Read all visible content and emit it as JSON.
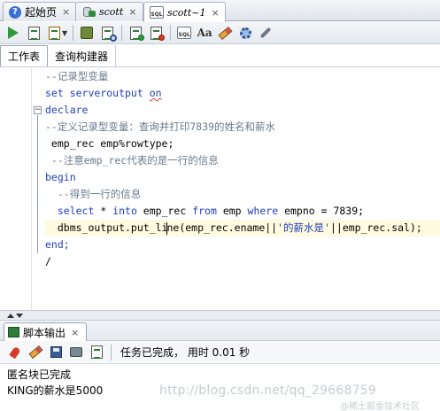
{
  "doc_tabs": [
    {
      "label": "起始页",
      "icon": "help-icon",
      "close": "×"
    },
    {
      "label": "scott",
      "icon": "database-connection-icon",
      "close": "×"
    },
    {
      "label": "scott~1",
      "icon": "sql-worksheet-icon",
      "close": "×",
      "active": true
    }
  ],
  "toolbar": {
    "items": [
      "run-statement-icon",
      "run-script-icon",
      "commit-icon",
      "rollback-icon",
      "explain-plan-icon",
      "autotrace-icon",
      "sql-history-icon",
      "to-upper-lower-icon",
      "clear-icon",
      "tuning-advisor-icon",
      "monitor-icon"
    ]
  },
  "sub_tabs": [
    "工作表",
    "查询构建器"
  ],
  "editor": {
    "lines": [
      {
        "parts": [
          {
            "t": "--记录型变量",
            "c": "cmt"
          }
        ]
      },
      {
        "parts": [
          {
            "t": "set serveroutput ",
            "c": "kw"
          },
          {
            "t": "on",
            "c": "kw squiggle"
          }
        ]
      },
      {
        "parts": [
          {
            "t": "declare",
            "c": "kw"
          }
        ]
      },
      {
        "parts": [
          {
            "t": "--定义记录型变量：查询并打印7839的姓名和薪水",
            "c": "cmt"
          }
        ]
      },
      {
        "parts": [
          {
            "t": " emp_rec emp%rowtype;",
            "c": "plain"
          }
        ]
      },
      {
        "parts": [
          {
            "t": " --注意emp_rec代表的是一行的信息",
            "c": "cmt"
          }
        ]
      },
      {
        "parts": [
          {
            "t": "begin",
            "c": "kw"
          }
        ]
      },
      {
        "parts": [
          {
            "t": "  --得到一行的信息",
            "c": "cmt"
          }
        ]
      },
      {
        "parts": [
          {
            "t": "  select",
            "c": "kw"
          },
          {
            "t": " * ",
            "c": "plain"
          },
          {
            "t": "into",
            "c": "kw"
          },
          {
            "t": " emp_rec ",
            "c": "plain"
          },
          {
            "t": "from",
            "c": "kw"
          },
          {
            "t": " emp ",
            "c": "plain"
          },
          {
            "t": "where",
            "c": "kw"
          },
          {
            "t": " empno = 7839;",
            "c": "plain"
          }
        ]
      },
      {
        "parts": [
          {
            "t": "  dbms_output.put_li",
            "c": "plain"
          },
          {
            "t": "ne(emp_rec.ename||",
            "c": "plain"
          },
          {
            "t": "'的薪水是'",
            "c": "str"
          },
          {
            "t": "||emp_rec.sal);",
            "c": "plain"
          }
        ],
        "caret_after_part": 0,
        "highlight": true
      },
      {
        "parts": [
          {
            "t": "end;",
            "c": "kw"
          }
        ]
      },
      {
        "parts": [
          {
            "t": "/",
            "c": "plain"
          }
        ]
      }
    ]
  },
  "output": {
    "tab_label": "脚本输出",
    "close": "×",
    "status": "任务已完成， 用时 0.01 秒",
    "lines": [
      "匿名块已完成",
      "KING的薪水是5000"
    ]
  },
  "watermark": {
    "url": "http://blog.csdn.net/qq_29668759",
    "brand": "@稀土掘金技术社区"
  }
}
